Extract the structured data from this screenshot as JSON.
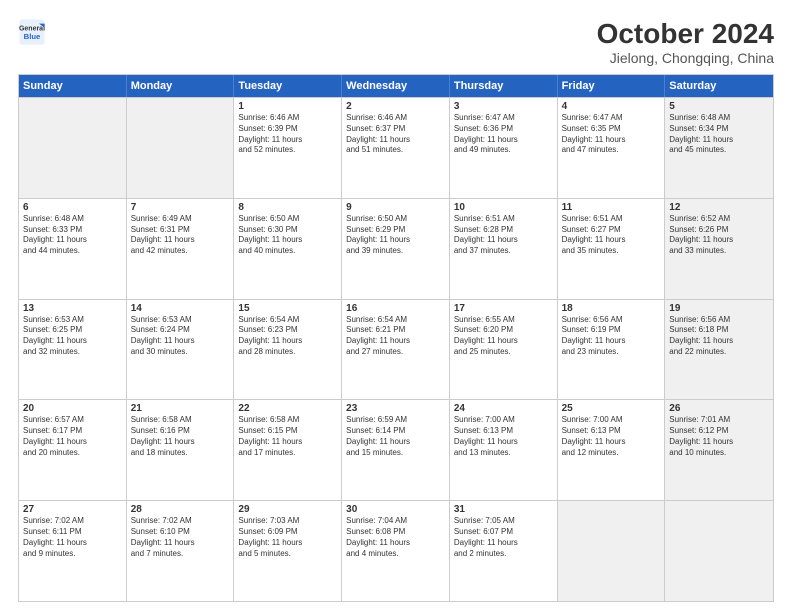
{
  "logo": {
    "line1": "General",
    "line2": "Blue"
  },
  "title": "October 2024",
  "subtitle": "Jielong, Chongqing, China",
  "header_days": [
    "Sunday",
    "Monday",
    "Tuesday",
    "Wednesday",
    "Thursday",
    "Friday",
    "Saturday"
  ],
  "weeks": [
    [
      {
        "day": "",
        "info": "",
        "shaded": true
      },
      {
        "day": "",
        "info": "",
        "shaded": true
      },
      {
        "day": "1",
        "info": "Sunrise: 6:46 AM\nSunset: 6:39 PM\nDaylight: 11 hours\nand 52 minutes.",
        "shaded": false
      },
      {
        "day": "2",
        "info": "Sunrise: 6:46 AM\nSunset: 6:37 PM\nDaylight: 11 hours\nand 51 minutes.",
        "shaded": false
      },
      {
        "day": "3",
        "info": "Sunrise: 6:47 AM\nSunset: 6:36 PM\nDaylight: 11 hours\nand 49 minutes.",
        "shaded": false
      },
      {
        "day": "4",
        "info": "Sunrise: 6:47 AM\nSunset: 6:35 PM\nDaylight: 11 hours\nand 47 minutes.",
        "shaded": false
      },
      {
        "day": "5",
        "info": "Sunrise: 6:48 AM\nSunset: 6:34 PM\nDaylight: 11 hours\nand 45 minutes.",
        "shaded": true
      }
    ],
    [
      {
        "day": "6",
        "info": "Sunrise: 6:48 AM\nSunset: 6:33 PM\nDaylight: 11 hours\nand 44 minutes.",
        "shaded": false
      },
      {
        "day": "7",
        "info": "Sunrise: 6:49 AM\nSunset: 6:31 PM\nDaylight: 11 hours\nand 42 minutes.",
        "shaded": false
      },
      {
        "day": "8",
        "info": "Sunrise: 6:50 AM\nSunset: 6:30 PM\nDaylight: 11 hours\nand 40 minutes.",
        "shaded": false
      },
      {
        "day": "9",
        "info": "Sunrise: 6:50 AM\nSunset: 6:29 PM\nDaylight: 11 hours\nand 39 minutes.",
        "shaded": false
      },
      {
        "day": "10",
        "info": "Sunrise: 6:51 AM\nSunset: 6:28 PM\nDaylight: 11 hours\nand 37 minutes.",
        "shaded": false
      },
      {
        "day": "11",
        "info": "Sunrise: 6:51 AM\nSunset: 6:27 PM\nDaylight: 11 hours\nand 35 minutes.",
        "shaded": false
      },
      {
        "day": "12",
        "info": "Sunrise: 6:52 AM\nSunset: 6:26 PM\nDaylight: 11 hours\nand 33 minutes.",
        "shaded": true
      }
    ],
    [
      {
        "day": "13",
        "info": "Sunrise: 6:53 AM\nSunset: 6:25 PM\nDaylight: 11 hours\nand 32 minutes.",
        "shaded": false
      },
      {
        "day": "14",
        "info": "Sunrise: 6:53 AM\nSunset: 6:24 PM\nDaylight: 11 hours\nand 30 minutes.",
        "shaded": false
      },
      {
        "day": "15",
        "info": "Sunrise: 6:54 AM\nSunset: 6:23 PM\nDaylight: 11 hours\nand 28 minutes.",
        "shaded": false
      },
      {
        "day": "16",
        "info": "Sunrise: 6:54 AM\nSunset: 6:21 PM\nDaylight: 11 hours\nand 27 minutes.",
        "shaded": false
      },
      {
        "day": "17",
        "info": "Sunrise: 6:55 AM\nSunset: 6:20 PM\nDaylight: 11 hours\nand 25 minutes.",
        "shaded": false
      },
      {
        "day": "18",
        "info": "Sunrise: 6:56 AM\nSunset: 6:19 PM\nDaylight: 11 hours\nand 23 minutes.",
        "shaded": false
      },
      {
        "day": "19",
        "info": "Sunrise: 6:56 AM\nSunset: 6:18 PM\nDaylight: 11 hours\nand 22 minutes.",
        "shaded": true
      }
    ],
    [
      {
        "day": "20",
        "info": "Sunrise: 6:57 AM\nSunset: 6:17 PM\nDaylight: 11 hours\nand 20 minutes.",
        "shaded": false
      },
      {
        "day": "21",
        "info": "Sunrise: 6:58 AM\nSunset: 6:16 PM\nDaylight: 11 hours\nand 18 minutes.",
        "shaded": false
      },
      {
        "day": "22",
        "info": "Sunrise: 6:58 AM\nSunset: 6:15 PM\nDaylight: 11 hours\nand 17 minutes.",
        "shaded": false
      },
      {
        "day": "23",
        "info": "Sunrise: 6:59 AM\nSunset: 6:14 PM\nDaylight: 11 hours\nand 15 minutes.",
        "shaded": false
      },
      {
        "day": "24",
        "info": "Sunrise: 7:00 AM\nSunset: 6:13 PM\nDaylight: 11 hours\nand 13 minutes.",
        "shaded": false
      },
      {
        "day": "25",
        "info": "Sunrise: 7:00 AM\nSunset: 6:13 PM\nDaylight: 11 hours\nand 12 minutes.",
        "shaded": false
      },
      {
        "day": "26",
        "info": "Sunrise: 7:01 AM\nSunset: 6:12 PM\nDaylight: 11 hours\nand 10 minutes.",
        "shaded": true
      }
    ],
    [
      {
        "day": "27",
        "info": "Sunrise: 7:02 AM\nSunset: 6:11 PM\nDaylight: 11 hours\nand 9 minutes.",
        "shaded": false
      },
      {
        "day": "28",
        "info": "Sunrise: 7:02 AM\nSunset: 6:10 PM\nDaylight: 11 hours\nand 7 minutes.",
        "shaded": false
      },
      {
        "day": "29",
        "info": "Sunrise: 7:03 AM\nSunset: 6:09 PM\nDaylight: 11 hours\nand 5 minutes.",
        "shaded": false
      },
      {
        "day": "30",
        "info": "Sunrise: 7:04 AM\nSunset: 6:08 PM\nDaylight: 11 hours\nand 4 minutes.",
        "shaded": false
      },
      {
        "day": "31",
        "info": "Sunrise: 7:05 AM\nSunset: 6:07 PM\nDaylight: 11 hours\nand 2 minutes.",
        "shaded": false
      },
      {
        "day": "",
        "info": "",
        "shaded": true
      },
      {
        "day": "",
        "info": "",
        "shaded": true
      }
    ]
  ]
}
